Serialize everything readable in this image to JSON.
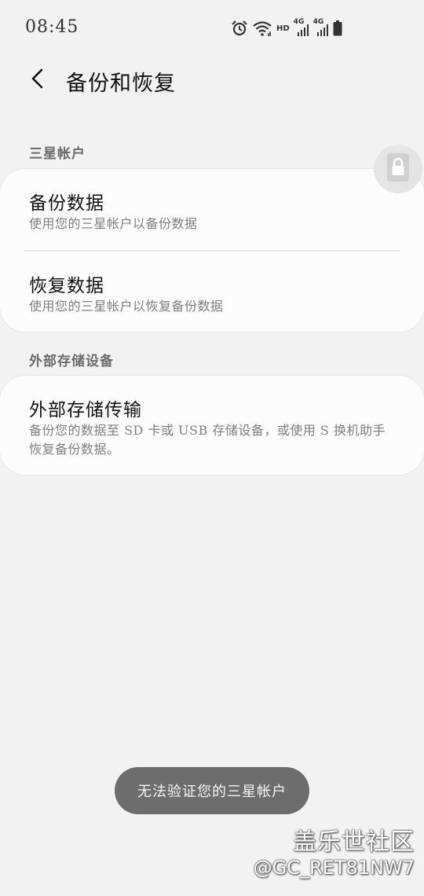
{
  "status_bar": {
    "time": "08:45",
    "hd_label": "HD",
    "network_1": "4G",
    "network_2": "4G",
    "icons": [
      "alarm-icon",
      "wifi-icon",
      "signal-icon",
      "signal-icon",
      "battery-icon"
    ]
  },
  "header": {
    "title": "备份和恢复",
    "back_icon": "chevron-left-icon"
  },
  "sections": [
    {
      "label": "三星帐户",
      "items": [
        {
          "title": "备份数据",
          "subtitle": "使用您的三星帐户以备份数据"
        },
        {
          "title": "恢复数据",
          "subtitle": "使用您的三星帐户以恢复备份数据"
        }
      ]
    },
    {
      "label": "外部存储设备",
      "items": [
        {
          "title": "外部存储传输",
          "subtitle": "备份您的数据至 SD 卡或 USB 存储设备，或使用 S 换机助手恢复备份数据。"
        }
      ]
    }
  ],
  "lock_icon": "lock-icon",
  "toast": "无法验证您的三星帐户",
  "watermark": {
    "brand": "盖乐世社区",
    "user": "@GC_RET81NW7"
  },
  "colors": {
    "background": "#f2f2f2",
    "card": "#fcfcfc",
    "toast_bg": "#6d6d6d",
    "subtitle": "#7e7e7e"
  }
}
